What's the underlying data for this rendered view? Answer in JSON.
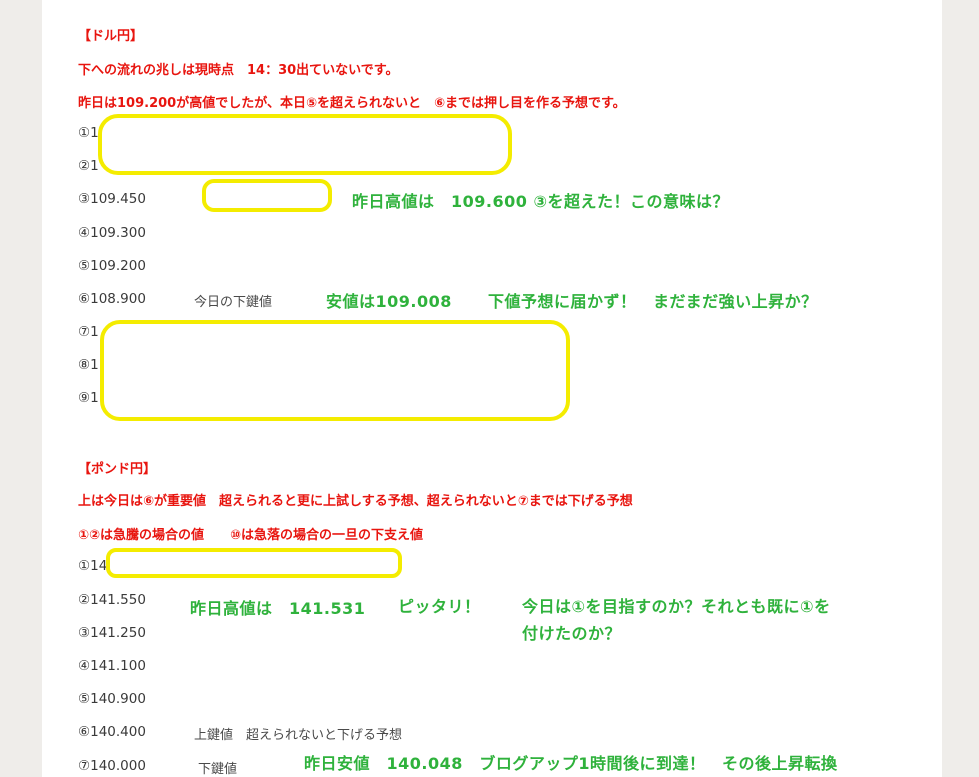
{
  "usdjpy": {
    "heading": "【ドル円】",
    "intro1": "下への流れの兆しは現時点　14：30出ていないです。",
    "intro2": "昨日は109.200が高値でしたが、本日⑤を超えられないと　⑥までは押し目を作る予想です。",
    "levels": [
      "①1",
      "②1",
      "③109.450",
      "④109.300",
      "⑤109.200",
      "⑥108.900",
      "⑦1",
      "⑧1",
      "⑨1"
    ],
    "note6": "今日の下鍵値",
    "comment3": "昨日高値は　109.600 ③を超えた！この意味は？",
    "comment6a": "安値は109.008",
    "comment6b": "下値予想に届かず！　まだまだ強い上昇か？"
  },
  "gbpjpy": {
    "heading": "【ポンド円】",
    "intro1": "上は今日は⑥が重要値　超えられると更に上試しする予想、超えられないと⑦までは下げる予想",
    "intro2": "①②は急騰の場合の値　　⑩は急落の場合の一旦の下支え値",
    "levels": [
      "①14",
      "②141.550",
      "③141.250",
      "④141.100",
      "⑤140.900",
      "⑥140.400",
      "⑦140.000"
    ],
    "note6": "上鍵値　超えられないと下げる予想",
    "note7": "下鍵値",
    "comment2a": "昨日高値は　141.531",
    "comment2b": "ピッタリ！",
    "comment2c": "今日は①を目指すのか？それとも既に①を",
    "comment2d": "付けたのか？",
    "comment7": "昨日安値　140.048　ブログアップ1時間後に到達！　その後上昇転換"
  },
  "colors": {
    "heading_red": "#e8150f",
    "comment_green": "#2fb23c",
    "highlight_yellow": "#f4ec00"
  }
}
